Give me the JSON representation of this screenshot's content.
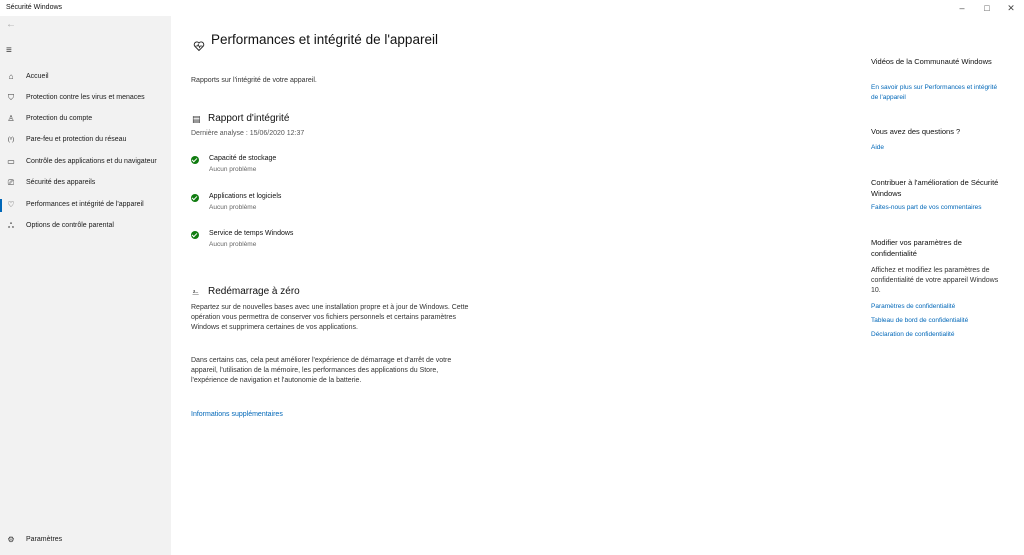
{
  "window": {
    "title": "Sécurité Windows",
    "controls": {
      "minimize": "–",
      "maximize": "□",
      "close": "✕"
    }
  },
  "sidebar": {
    "back_glyph": "←",
    "menu_glyph": "≡",
    "items": [
      {
        "label": "Accueil",
        "icon": "home-icon",
        "glyph": "⌂",
        "active": false
      },
      {
        "label": "Protection contre les virus et menaces",
        "icon": "shield-icon",
        "glyph": "⛉",
        "active": false
      },
      {
        "label": "Protection du compte",
        "icon": "person-icon",
        "glyph": "♙",
        "active": false
      },
      {
        "label": "Pare-feu et protection du réseau",
        "icon": "wifi-icon",
        "glyph": "(ᵒ)",
        "active": false
      },
      {
        "label": "Contrôle des applications et du navigateur",
        "icon": "browser-icon",
        "glyph": "▭",
        "active": false
      },
      {
        "label": "Sécurité des appareils",
        "icon": "laptop-icon",
        "glyph": "⎚",
        "active": false
      },
      {
        "label": "Performances et intégrité de l'appareil",
        "icon": "heart-pulse-icon",
        "glyph": "♡",
        "active": true
      },
      {
        "label": "Options de contrôle parental",
        "icon": "family-icon",
        "glyph": "ஃ",
        "active": false
      }
    ],
    "settings": {
      "label": "Paramètres",
      "icon": "gear-icon",
      "glyph": "⚙"
    }
  },
  "main": {
    "title": "Performances et intégrité de l'appareil",
    "subtitle": "Rapports sur l'intégrité de votre appareil.",
    "health_report": {
      "heading": "Rapport d'intégrité",
      "icon_glyph": "▤",
      "last_scan": "Dernière analyse : 15/06/2020 12:37",
      "items": [
        {
          "name": "Capacité de stockage",
          "status": "Aucun problème"
        },
        {
          "name": "Applications et logiciels",
          "status": "Aucun problème"
        },
        {
          "name": "Service de temps Windows",
          "status": "Aucun problème"
        }
      ]
    },
    "fresh_start": {
      "heading": "Redémarrage à zéro",
      "icon_glyph": "⎁",
      "para1": "Repartez sur de nouvelles bases avec une installation propre et à jour de Windows. Cette opération vous permettra de conserver vos fichiers personnels et certains paramètres Windows et supprimera certaines de vos applications.",
      "para2": "Dans certains cas, cela peut améliorer l'expérience de démarrage et d'arrêt de votre appareil, l'utilisation de la mémoire, les performances des applications du Store, l'expérience de navigation et l'autonomie de la batterie.",
      "more_info": "Informations supplémentaires"
    }
  },
  "right": {
    "videos": {
      "heading": "Vidéos de la Communauté Windows",
      "link": "En savoir plus sur Performances et intégrité de l'appareil"
    },
    "questions": {
      "heading": "Vous avez des questions ?",
      "link": "Aide"
    },
    "improve": {
      "heading": "Contribuer à l'amélioration de Sécurité Windows",
      "link": "Faites-nous part de vos commentaires"
    },
    "privacy": {
      "heading": "Modifier vos paramètres de confidentialité",
      "text": "Affichez et modifiez les paramètres de confidentialité de votre appareil Windows 10.",
      "links": [
        "Paramètres de confidentialité",
        "Tableau de bord de confidentialité",
        "Déclaration de confidentialité"
      ]
    }
  },
  "colors": {
    "accent": "#0067b8",
    "ok": "#107c10",
    "sidebar_bg": "#f2f2f2"
  }
}
